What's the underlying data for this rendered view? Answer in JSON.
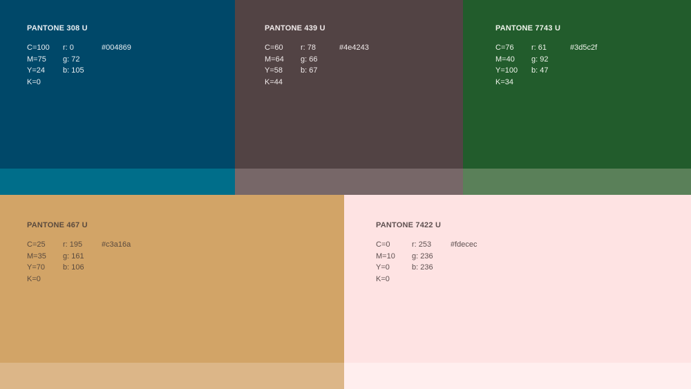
{
  "swatches": [
    {
      "name": "PANTONE 308 U",
      "c": "C=100",
      "m": "M=75",
      "y": "Y=24",
      "k": "K=0",
      "r": "r: 0",
      "g": "g: 72",
      "b": "b: 105",
      "hex": "#004869",
      "bg": "#004869",
      "band": "#006e8a",
      "text": "#e8eef2"
    },
    {
      "name": "PANTONE 439 U",
      "c": "C=60",
      "m": "M=64",
      "y": "Y=58",
      "k": "K=44",
      "r": "r: 78",
      "g": "g: 66",
      "b": "b: 67",
      "hex": "#4e4243",
      "bg": "#524344",
      "band": "#776768",
      "text": "#f0eaea"
    },
    {
      "name": "PANTONE 7743 U",
      "c": "C=76",
      "m": "M=40",
      "y": "Y=100",
      "k": "K=34",
      "r": "r: 61",
      "g": "g: 92",
      "b": "b: 47",
      "hex": "#3d5c2f",
      "bg": "#225c2c",
      "band": "#5a8059",
      "text": "#eef3ea"
    },
    {
      "name": "PANTONE 467 U",
      "c": "C=25",
      "m": "M=35",
      "y": "Y=70",
      "k": "K=0",
      "r": "r: 195",
      "g": "g: 161",
      "b": "b: 106",
      "hex": "#c3a16a",
      "bg": "#d2a467",
      "band": "#dcb688",
      "text": "#5a4a3e"
    },
    {
      "name": "PANTONE 7422 U",
      "c": "C=0",
      "m": "M=10",
      "y": "Y=0",
      "k": "K=0",
      "r": "r: 253",
      "g": "g: 236",
      "b": "b: 236",
      "hex": "#fdecec",
      "bg": "#fee3e3",
      "band": "#ffeeee",
      "text": "#5e5050"
    }
  ]
}
